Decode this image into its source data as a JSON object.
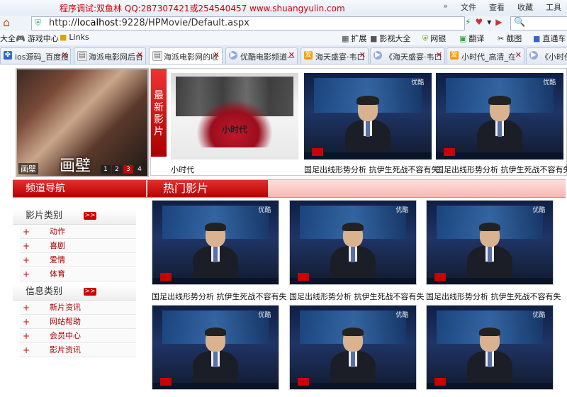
{
  "browser": {
    "title": "程序调试:双鱼林 QQ:287307421或254540457 www.shuangyulin.com",
    "menu": [
      "文件",
      "查看",
      "收藏",
      "工具"
    ],
    "url_prefix": "http://",
    "url_host": "localhost",
    "url_path": ":9228/HPMovie/Default.aspx",
    "search_icon": "search-icon"
  },
  "bookmarks": [
    "大全",
    "游戏中心",
    "Links",
    "扩展",
    "影视大全",
    "网银",
    "翻译",
    "截图",
    "直通车"
  ],
  "tabs": [
    {
      "label": "ios源码_百度搜",
      "active": false
    },
    {
      "label": "海派电影网后台",
      "active": false
    },
    {
      "label": "海派电影网的收",
      "active": true
    },
    {
      "label": "优酷电影频道—",
      "active": false
    },
    {
      "label": "海天盛宴·韦口",
      "active": false
    },
    {
      "label": "《海天盛宴·韦口",
      "active": false
    },
    {
      "label": "小时代_高清_在",
      "active": false
    },
    {
      "label": "《小时代》",
      "active": false
    }
  ],
  "featured": {
    "poster_title": "画壁",
    "caption": "画壁",
    "pager": [
      "1",
      "2",
      "3",
      "4"
    ],
    "pager_active": 2
  },
  "latest": {
    "label": "最新影片",
    "poster2_text": "小时代",
    "items": [
      {
        "caption": "小时代"
      },
      {
        "caption": "国足出线形势分析 抗伊生死战不容有失",
        "logo": "优酷"
      },
      {
        "caption": "国足出线形势分析 抗伊生死战不容有失",
        "logo": "优酷"
      }
    ]
  },
  "channel_nav": {
    "title": "频道导航"
  },
  "hot": {
    "title": "热门影片",
    "items": [
      {
        "caption": "国足出线形势分析 抗伊生死战不容有失",
        "logo": "优酷"
      },
      {
        "caption": "国足出线形势分析 抗伊生死战不容有失",
        "logo": "优酷"
      },
      {
        "caption": "国足出线形势分析 抗伊生死战不容有失",
        "logo": "优酷"
      },
      {
        "caption": "",
        "logo": "优酷"
      },
      {
        "caption": "",
        "logo": "优酷"
      },
      {
        "caption": "",
        "logo": "优酷"
      }
    ]
  },
  "sidebar": {
    "movie_types": {
      "title": "影片类别",
      "more": ">>",
      "items": [
        "动作",
        "喜剧",
        "爱情",
        "体育"
      ]
    },
    "info_types": {
      "title": "信息类别",
      "more": ">>",
      "items": [
        "新片资讯",
        "网站帮助",
        "会员中心",
        "影片资讯"
      ]
    }
  }
}
